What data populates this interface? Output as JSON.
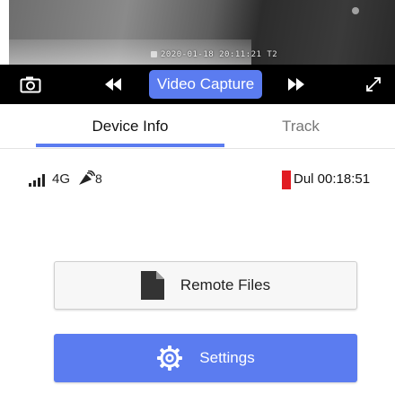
{
  "video": {
    "timestamp": "2020-01-18 20:11:21",
    "channel": "T2"
  },
  "controls": {
    "camera_icon": "camera-icon",
    "rewind_icon": "rewind-icon",
    "capture_label": "Video Capture",
    "forward_icon": "fast-forward-icon",
    "expand_icon": "expand-icon"
  },
  "tabs": [
    {
      "label": "Device Info",
      "active": true
    },
    {
      "label": "Track",
      "active": false
    }
  ],
  "status": {
    "signal_icon": "signal-bars-icon",
    "network": "4G",
    "satellite_icon": "satellite-icon",
    "satellite_count": "8",
    "recording_label": "Dul 00:18:51"
  },
  "actions": {
    "remote_files_label": "Remote Files",
    "settings_label": "Settings"
  },
  "colors": {
    "accent": "#5b7cf0",
    "record": "#e11b22",
    "controls_bg": "#000000"
  }
}
